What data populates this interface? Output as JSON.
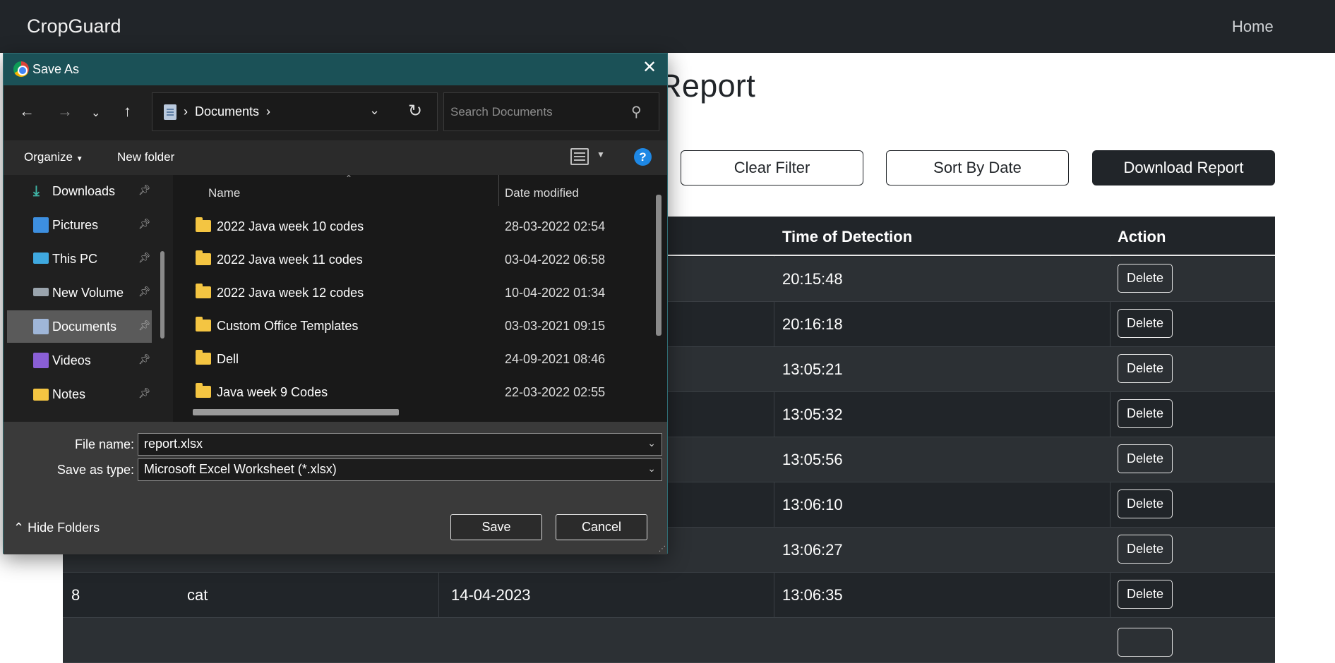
{
  "navbar": {
    "brand": "CropGuard",
    "home": "Home"
  },
  "page": {
    "title_fragment": "Report"
  },
  "buttons": {
    "clear_filter": "Clear Filter",
    "sort_by_date": "Sort By Date",
    "download_report": "Download Report"
  },
  "table": {
    "headers": {
      "time": "Time of Detection",
      "action": "Action"
    },
    "rows": [
      {
        "id": "",
        "name": "",
        "date": "",
        "time": "20:15:48",
        "action": "Delete"
      },
      {
        "id": "",
        "name": "",
        "date": "",
        "time": "20:16:18",
        "action": "Delete"
      },
      {
        "id": "",
        "name": "",
        "date": "",
        "time": "13:05:21",
        "action": "Delete"
      },
      {
        "id": "",
        "name": "",
        "date": "",
        "time": "13:05:32",
        "action": "Delete"
      },
      {
        "id": "",
        "name": "",
        "date": "",
        "time": "13:05:56",
        "action": "Delete"
      },
      {
        "id": "",
        "name": "",
        "date": "",
        "time": "13:06:10",
        "action": "Delete"
      },
      {
        "id": "",
        "name": "",
        "date": "",
        "time": "13:06:27",
        "action": "Delete"
      },
      {
        "id": "8",
        "name": "cat",
        "date": "14-04-2023",
        "time": "13:06:35",
        "action": "Delete"
      }
    ]
  },
  "dialog": {
    "title": "Save As",
    "close_glyph": "✕",
    "address": {
      "location": "Documents"
    },
    "search": {
      "placeholder": "Search Documents"
    },
    "toolbar": {
      "organize": "Organize",
      "new_folder": "New folder",
      "help": "?"
    },
    "nav_items": [
      {
        "label": "Downloads",
        "icon": "download-icon",
        "color": "#3fb5a6"
      },
      {
        "label": "Pictures",
        "icon": "pictures-icon",
        "color": "#3d8fe0"
      },
      {
        "label": "This PC",
        "icon": "computer-icon",
        "color": "#3fa9e0"
      },
      {
        "label": "New Volume",
        "icon": "drive-icon",
        "color": "#9aa4ad"
      },
      {
        "label": "Documents",
        "icon": "documents-icon",
        "color": "#9fb6d8"
      },
      {
        "label": "Videos",
        "icon": "videos-icon",
        "color": "#8a5fd6"
      },
      {
        "label": "Notes",
        "icon": "folder-icon",
        "color": "#f4c542"
      }
    ],
    "selected_nav": "Documents",
    "columns": {
      "name": "Name",
      "date_modified": "Date modified"
    },
    "files": [
      {
        "name": "2022 Java week 10 codes",
        "date": "28-03-2022 02:54"
      },
      {
        "name": "2022 Java week 11 codes",
        "date": "03-04-2022 06:58"
      },
      {
        "name": "2022 Java week 12 codes",
        "date": "10-04-2022 01:34"
      },
      {
        "name": "Custom Office Templates",
        "date": "03-03-2021 09:15"
      },
      {
        "name": "Dell",
        "date": "24-09-2021 08:46"
      },
      {
        "name": "Java week 9 Codes",
        "date": "22-03-2022 02:55"
      }
    ],
    "file_name": {
      "label": "File name:",
      "value": "report.xlsx"
    },
    "save_as_type": {
      "label": "Save as type:",
      "value": "Microsoft Excel Worksheet (*.xlsx)"
    },
    "hide_folders": "Hide Folders",
    "save": "Save",
    "cancel": "Cancel"
  }
}
